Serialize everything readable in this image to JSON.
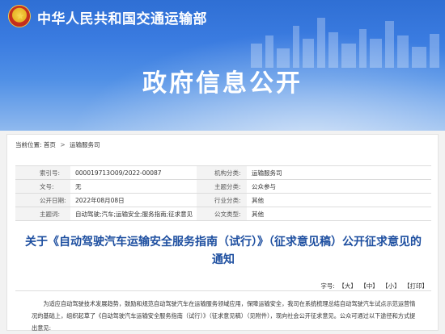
{
  "header": {
    "ministry_name": "中华人民共和国交通运输部",
    "banner_title": "政府信息公开"
  },
  "breadcrumb": {
    "label": "当前位置:",
    "items": [
      "首页",
      "运输服务司"
    ]
  },
  "meta": {
    "index_label": "索引号:",
    "index_value": "000019713O09/2022-00087",
    "org_label": "机构分类:",
    "org_value": "运输服务司",
    "docno_label": "文号:",
    "docno_value": "无",
    "topic_label": "主题分类:",
    "topic_value": "公众参与",
    "date_label": "公开日期:",
    "date_value": "2022年08月08日",
    "industry_label": "行业分类:",
    "industry_value": "其他",
    "keywords_label": "主题词:",
    "keywords_value": "自动驾驶;汽车;运输安全;服务指南;征求意见",
    "type_label": "公文类型:",
    "type_value": "其他"
  },
  "document": {
    "title": "关于《自动驾驶汽车运输安全服务指南（试行）》（征求意见稿）公开征求意见的通知",
    "font_size_label": "字号:",
    "size_large": "【大】",
    "size_medium": "【中】",
    "size_small": "【小】",
    "print": "【打印】",
    "paragraph1": "为适应自动驾驶技术发展趋势，鼓励和规范自动驾驶汽车在运输服务领域应用，保障运输安全，我司在系统梳理总结自动驾驶汽车试点示范运营情况的基础上，组织起草了《自动驾驶汽车运输安全服务指南（试行）》（征求意见稿）（见附件），现向社会公开征求意见。公众可通过以下途径和方式提出意见:"
  },
  "colors": {
    "banner_blue": "#3a7be0",
    "title_blue": "#1e4fa0"
  }
}
